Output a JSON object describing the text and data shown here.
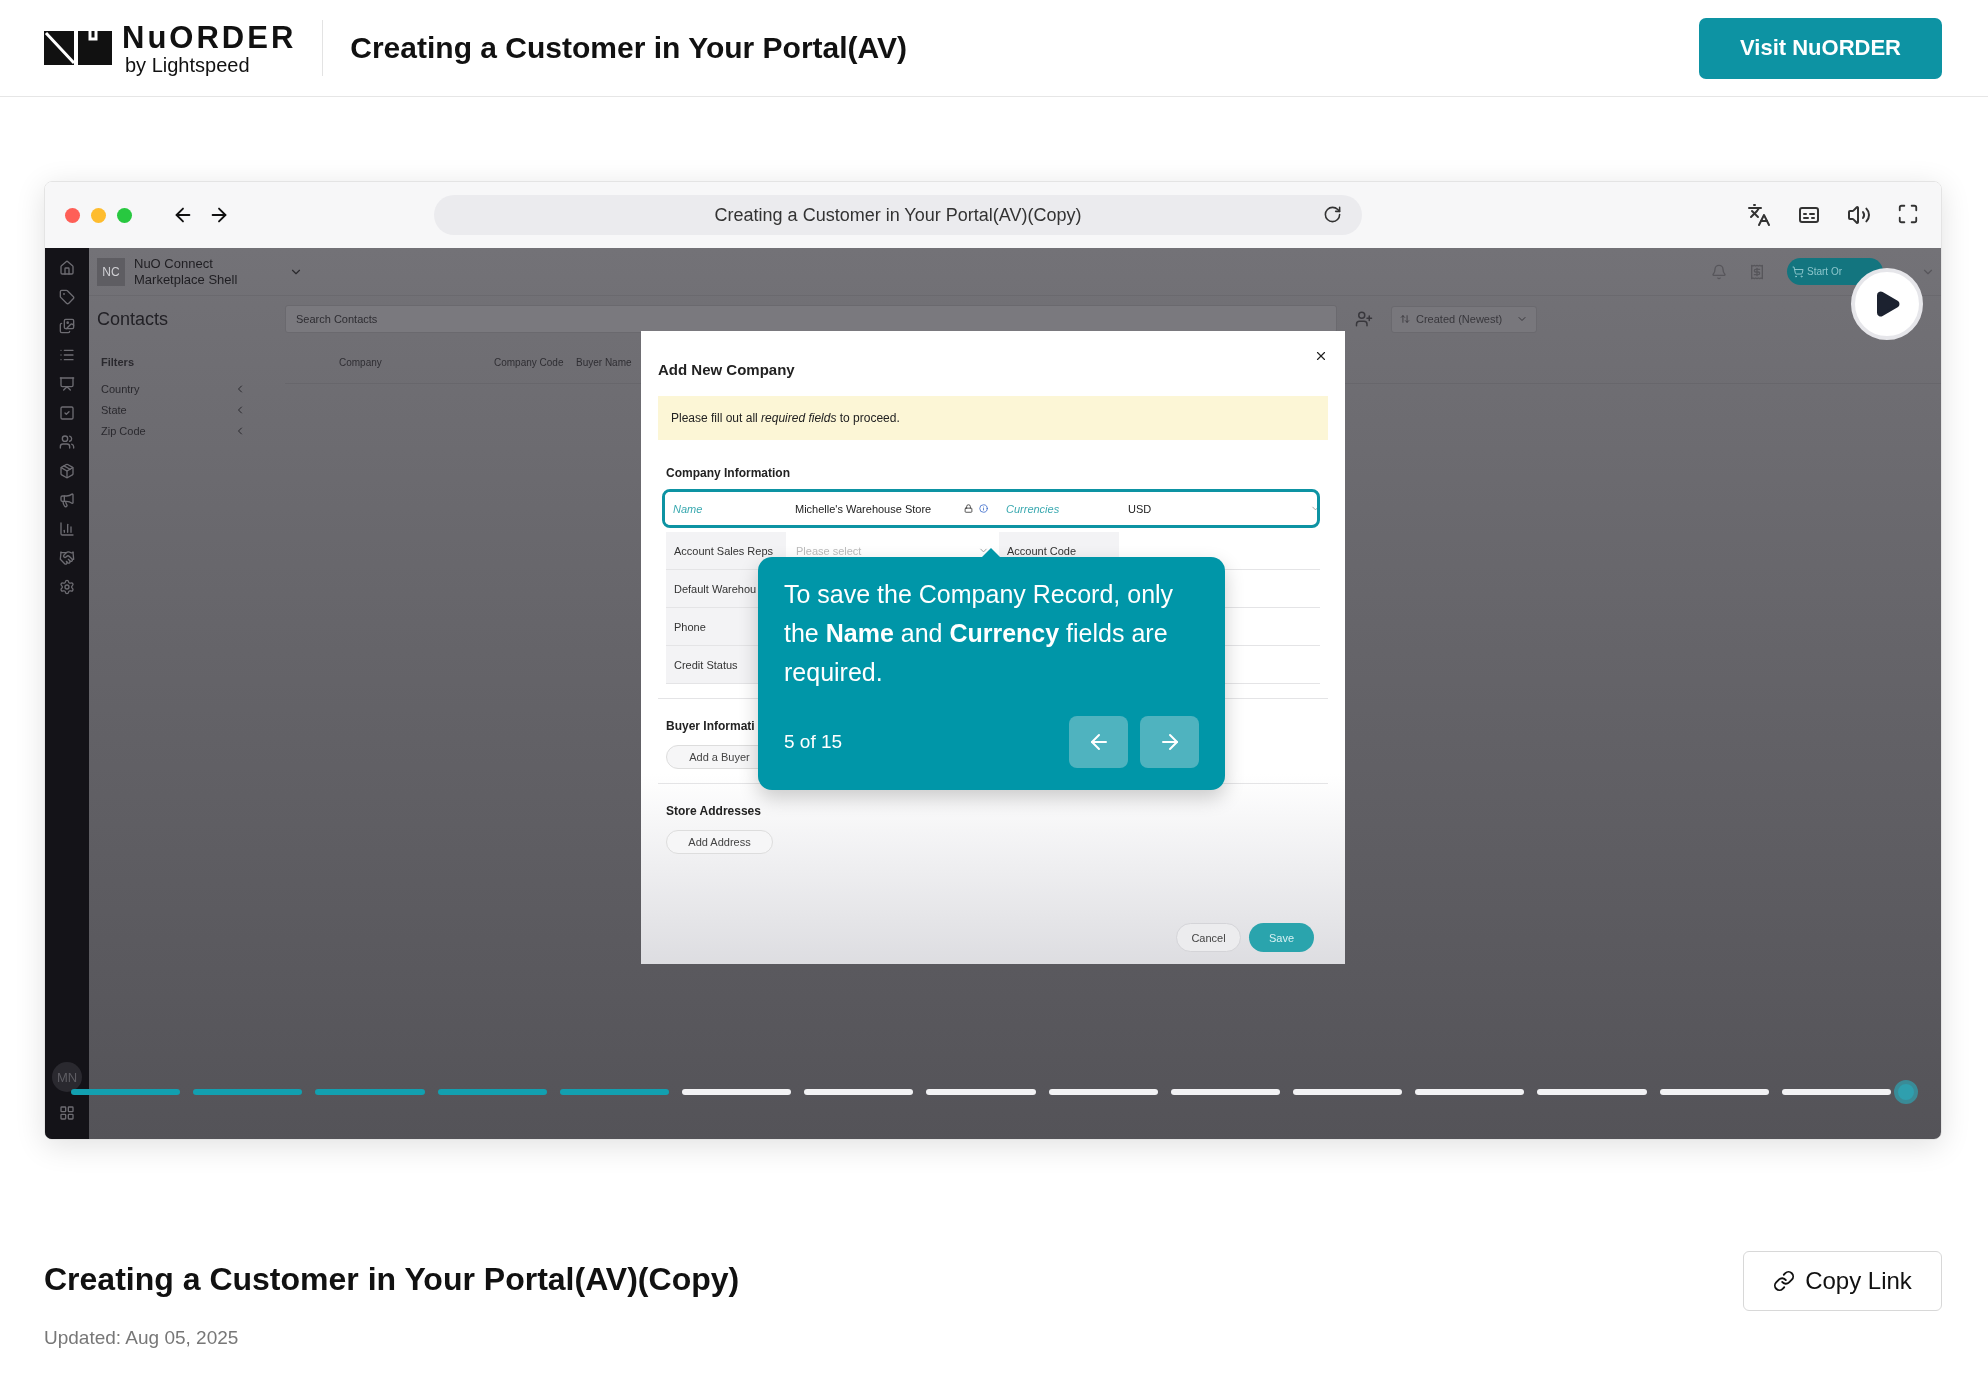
{
  "header": {
    "logo": {
      "wordmark": "NuORDER",
      "tagline": "by Lightspeed"
    },
    "title": "Creating a Customer in Your Portal(AV)",
    "visit_button": "Visit NuORDER"
  },
  "player": {
    "address": "Creating a Customer in Your Portal(AV)(Copy)",
    "app": {
      "account": {
        "initials": "NC",
        "name": "NuO Connect Marketplace Shell"
      },
      "start_button": "Start Or",
      "page_title": "Contacts",
      "search": {
        "placeholder": "Search Contacts"
      },
      "sort": "Created (Newest)",
      "filters": {
        "title": "Filters",
        "items": [
          "Country",
          "State",
          "Zip Code"
        ]
      },
      "columns": [
        "Company",
        "Company Code",
        "Buyer Name"
      ],
      "user_initials": "MN"
    },
    "modal": {
      "title": "Add New Company",
      "alert": "Please fill out all *required fields* to proceed.",
      "section_title": "Company Information",
      "rows": [
        {
          "highlighted": true,
          "fields": [
            {
              "label": "Name",
              "kind": "text",
              "value": "Michelle's Warehouse Store",
              "required": true
            },
            {
              "label": "Currencies",
              "kind": "select",
              "value": "USD",
              "required": true
            }
          ]
        },
        {
          "highlighted": false,
          "fields": [
            {
              "label": "Account Sales Reps",
              "kind": "select",
              "placeholder": "Please select",
              "required": false
            },
            {
              "label": "Account Code",
              "kind": "text",
              "required": false
            }
          ]
        },
        {
          "highlighted": false,
          "fields": [
            {
              "label": "Default Warehou",
              "kind": "text",
              "required": false
            }
          ]
        },
        {
          "highlighted": false,
          "fields": [
            {
              "label": "Phone",
              "kind": "text",
              "required": false
            }
          ]
        },
        {
          "highlighted": false,
          "fields": [
            {
              "label": "Credit Status",
              "kind": "text",
              "required": false
            }
          ]
        }
      ],
      "sections": [
        {
          "title": "Buyer Informati",
          "button": "Add a Buyer"
        },
        {
          "title": "Store Addresses",
          "button": "Add Address"
        }
      ],
      "buttons": [
        {
          "label": "Cancel",
          "primary": false
        },
        {
          "label": "Save",
          "primary": true
        }
      ]
    },
    "tooltip": {
      "text": "To save the Company Record, only the **Name** and **Currency** fields are required.",
      "step": "5 of 15"
    },
    "progress": [
      {
        "completed": true
      },
      {
        "completed": true
      },
      {
        "completed": true
      },
      {
        "completed": true
      },
      {
        "completed": true
      },
      {
        "completed": false
      },
      {
        "completed": false
      },
      {
        "completed": false
      },
      {
        "completed": false
      },
      {
        "completed": false
      },
      {
        "completed": false
      },
      {
        "completed": false
      },
      {
        "completed": false
      },
      {
        "completed": false
      },
      {
        "completed": false
      }
    ]
  },
  "footer": {
    "title": "Creating a Customer in Your Portal(AV)(Copy)",
    "updated": "Updated: Aug 05, 2025",
    "copy_button": "Copy Link"
  }
}
